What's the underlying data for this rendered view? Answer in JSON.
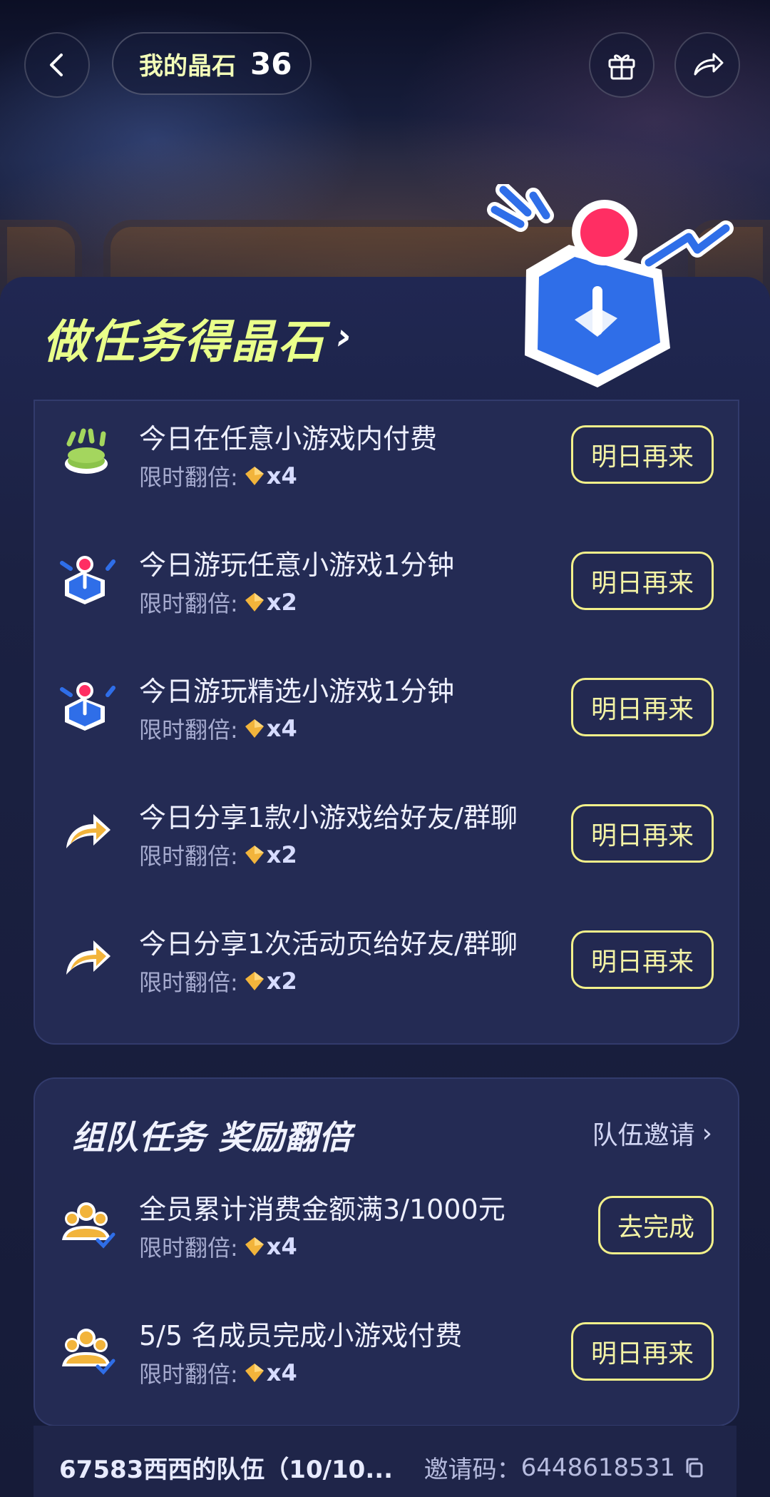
{
  "header": {
    "crystal_label": "我的晶石",
    "crystal_count": "36",
    "icons": [
      "back-icon",
      "gift-icon",
      "share-icon"
    ]
  },
  "tasks_section": {
    "title": "做任务得晶石",
    "title_arrow": "›",
    "items": [
      {
        "title": "今日在任意小游戏内付费",
        "sub_label": "限时翻倍:",
        "multiplier": "x4",
        "button": "明日再来",
        "icon": "coins-icon"
      },
      {
        "title": "今日游玩任意小游戏1分钟",
        "sub_label": "限时翻倍:",
        "multiplier": "x2",
        "button": "明日再来",
        "icon": "joystick-icon"
      },
      {
        "title": "今日游玩精选小游戏1分钟",
        "sub_label": "限时翻倍:",
        "multiplier": "x4",
        "button": "明日再来",
        "icon": "joystick-icon"
      },
      {
        "title": "今日分享1款小游戏给好友/群聊",
        "sub_label": "限时翻倍:",
        "multiplier": "x2",
        "button": "明日再来",
        "icon": "share-arrow-icon"
      },
      {
        "title": "今日分享1次活动页给好友/群聊",
        "sub_label": "限时翻倍:",
        "multiplier": "x2",
        "button": "明日再来",
        "icon": "share-arrow-icon"
      }
    ]
  },
  "team_section": {
    "title": "组队任务 奖励翻倍",
    "invite_link": "队伍邀请",
    "items": [
      {
        "title": "全员累计消费金额满3/1000元",
        "sub_label": "限时翻倍:",
        "multiplier": "x4",
        "button": "去完成",
        "icon": "team-icon"
      },
      {
        "title": "5/5 名成员完成小游戏付费",
        "sub_label": "限时翻倍:",
        "multiplier": "x4",
        "button": "明日再来",
        "icon": "team-icon"
      }
    ]
  },
  "footer": {
    "team_name": "67583西西的队伍（10/10...",
    "invite_code_label": "邀请码：",
    "invite_code": "6448618531"
  },
  "colors": {
    "accent_yellow": "#f2f08a",
    "title_green": "#e9ff8a",
    "card_bg": "#242b54",
    "page_bg": "#151a36",
    "mascot_blue": "#2f6ee8",
    "mascot_pink": "#ff2e63"
  }
}
